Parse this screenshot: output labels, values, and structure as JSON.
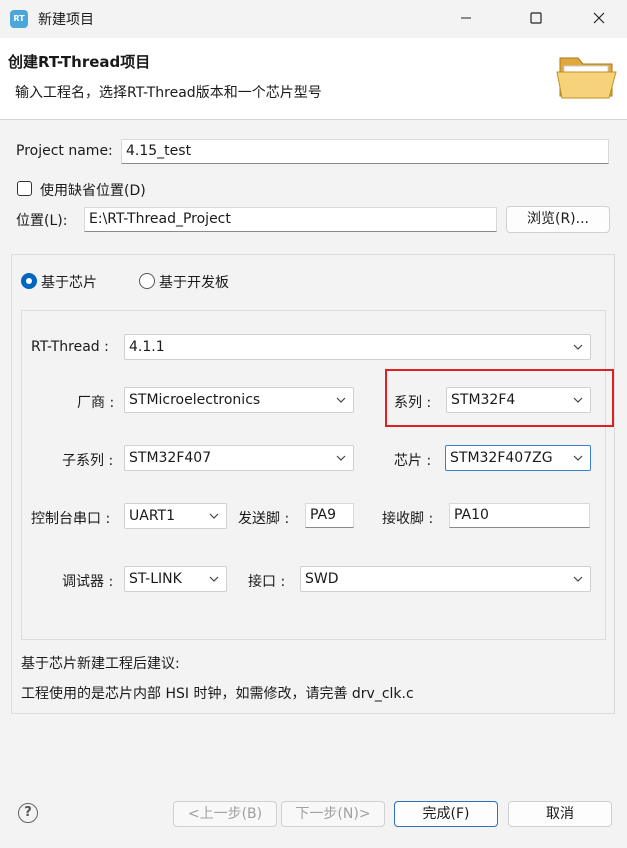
{
  "window": {
    "title": "新建项目",
    "icon_text": "RT"
  },
  "header": {
    "title": "创建RT-Thread项目",
    "subtitle": "输入工程名，选择RT-Thread版本和一个芯片型号"
  },
  "project_name": {
    "label": "Project name:",
    "value": "4.15_test"
  },
  "use_default_location": {
    "label": "使用缺省位置(D)",
    "checked": false
  },
  "location": {
    "label": "位置(L):",
    "value": "E:\\RT-Thread_Project",
    "browse_label": "浏览(R)..."
  },
  "mode": {
    "chip_label": "基于芯片",
    "board_label": "基于开发板",
    "selected": "chip"
  },
  "chip_config": {
    "rtthread_label": "RT-Thread :",
    "rtthread_value": "4.1.1",
    "vendor_label": "厂商 :",
    "vendor_value": "STMicroelectronics",
    "series_label": "系列 :",
    "series_value": "STM32F4",
    "subseries_label": "子系列 :",
    "subseries_value": "STM32F407",
    "chip_label": "芯片 :",
    "chip_value": "STM32F407ZG",
    "console_label": "控制台串口 :",
    "console_value": "UART1",
    "tx_label": "发送脚 :",
    "tx_value": "PA9",
    "rx_label": "接收脚 :",
    "rx_value": "PA10",
    "debugger_label": "调试器 :",
    "debugger_value": "ST-LINK",
    "interface_label": "接口 :",
    "interface_value": "SWD"
  },
  "advice": {
    "line1": "基于芯片新建工程后建议:",
    "line2": "工程使用的是芯片内部 HSI 时钟，如需修改，请完善 drv_clk.c"
  },
  "footer": {
    "back": "<上一步(B)",
    "next": "下一步(N)>",
    "finish": "完成(F)",
    "cancel": "取消"
  },
  "colors": {
    "accent": "#0067c0",
    "highlight": "#e02020"
  },
  "icons": [
    "rt-thread-app-icon",
    "minimize-icon",
    "maximize-icon",
    "close-icon",
    "folder-icon",
    "chevron-down-icon",
    "help-icon"
  ]
}
